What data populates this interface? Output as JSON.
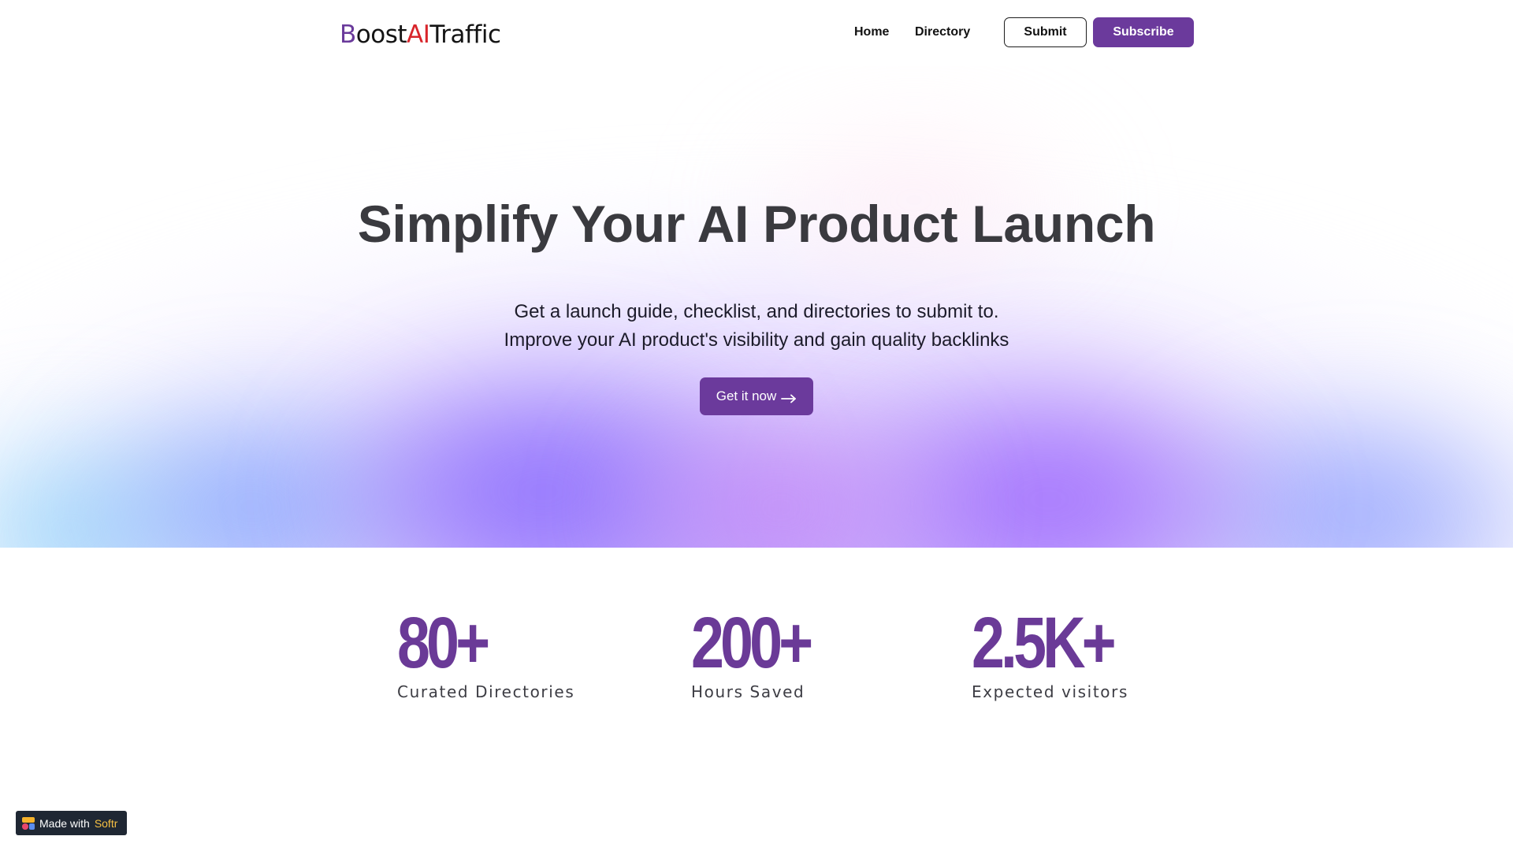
{
  "header": {
    "logo": {
      "part1": "B",
      "part2": "oost",
      "part3": "AI",
      "part4": "Traffic"
    },
    "nav": {
      "home": "Home",
      "directory": "Directory"
    },
    "buttons": {
      "submit": "Submit",
      "subscribe": "Subscribe"
    }
  },
  "hero": {
    "title": "Simplify Your AI Product Launch",
    "subtitle_line1": "Get a launch guide, checklist, and directories to submit to.",
    "subtitle_line2": "Improve your AI product's visibility and gain quality backlinks",
    "cta": "Get it now",
    "cta_icon": "arrow-right-icon"
  },
  "stats": [
    {
      "value": "80+",
      "label": "Curated Directories"
    },
    {
      "value": "200+",
      "label": "Hours Saved"
    },
    {
      "value": "2.5K+",
      "label": "Expected visitors"
    }
  ],
  "badge": {
    "prefix": "Made with",
    "brand": "Softr",
    "icon": "softr-logo-icon"
  },
  "colors": {
    "brand_purple": "#6b3a9c",
    "logo_red": "#d8252b",
    "stat_purple": "#6a3a97",
    "title_gray": "#3a3a3f",
    "badge_bg": "#1f2733",
    "badge_brand": "#f7c043"
  }
}
